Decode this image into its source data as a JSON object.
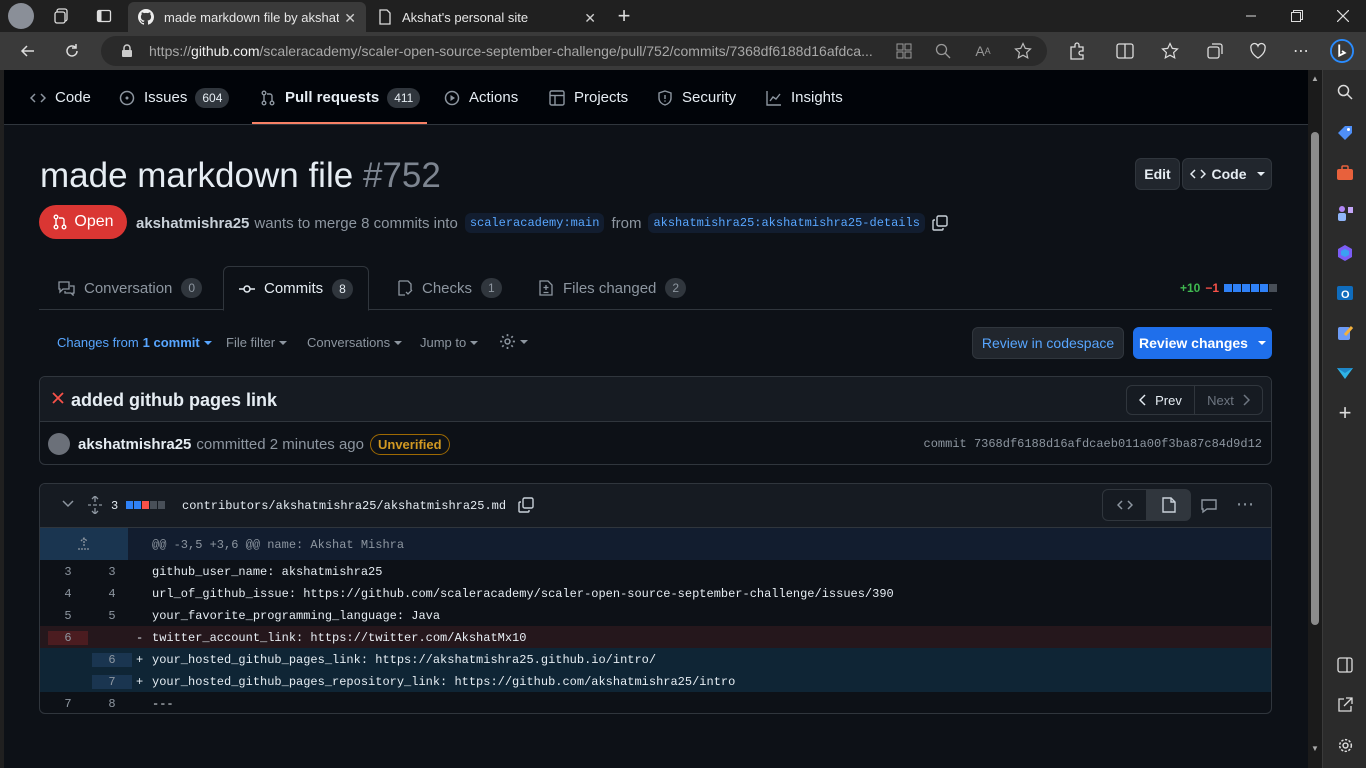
{
  "browser": {
    "tabs": [
      {
        "title": "made markdown file by akshatmishra25",
        "active": true
      },
      {
        "title": "Akshat's personal site",
        "active": false
      }
    ],
    "url_prefix": "https://",
    "url_domain": "github.com",
    "url_path": "/scaleracademy/scaler-open-source-september-challenge/pull/752/commits/7368df6188d16afdca..."
  },
  "repo_nav": {
    "code": "Code",
    "issues": "Issues",
    "issues_count": "604",
    "pulls": "Pull requests",
    "pulls_count": "411",
    "actions": "Actions",
    "projects": "Projects",
    "security": "Security",
    "insights": "Insights"
  },
  "pr": {
    "title": "made markdown file",
    "number": "#752",
    "edit_label": "Edit",
    "code_label": "Code",
    "state": "Open",
    "author": "akshatmishra25",
    "merge_text": "wants to merge 8 commits into",
    "base_branch": "scaleracademy:main",
    "from_text": "from",
    "head_branch": "akshatmishra25:akshatmishra25-details"
  },
  "pr_tabs": [
    {
      "label": "Conversation",
      "count": "0"
    },
    {
      "label": "Commits",
      "count": "8"
    },
    {
      "label": "Checks",
      "count": "1"
    },
    {
      "label": "Files changed",
      "count": "2"
    }
  ],
  "diffstat": {
    "additions": "+10",
    "deletions": "−1"
  },
  "toolbar": {
    "changes_from": "Changes from",
    "commit_count": "1 commit",
    "file_filter": "File filter",
    "conversations": "Conversations",
    "jump_to": "Jump to",
    "review_codespace": "Review in codespace",
    "review_changes": "Review changes"
  },
  "commit": {
    "message": "added github pages link",
    "prev": "Prev",
    "next": "Next",
    "author": "akshatmishra25",
    "action": "committed 2 minutes ago",
    "badge": "Unverified",
    "sha_label": "commit 7368df6188d16afdcaeb011a00f3ba87c84d9d12"
  },
  "file": {
    "changes": "3",
    "path": "contributors/akshatmishra25/akshatmishra25.md",
    "hunk": "@@ -3,5 +3,6 @@ name: Akshat Mishra",
    "lines": [
      {
        "old": "3",
        "new": "3",
        "sign": "",
        "text": "github_user_name: akshatmishra25",
        "type": "ctx"
      },
      {
        "old": "4",
        "new": "4",
        "sign": "",
        "text": "url_of_github_issue: https://github.com/scaleracademy/scaler-open-source-september-challenge/issues/390",
        "type": "ctx"
      },
      {
        "old": "5",
        "new": "5",
        "sign": "",
        "text": "your_favorite_programming_language: Java",
        "type": "ctx"
      },
      {
        "old": "6",
        "new": "",
        "sign": "-",
        "text": "twitter_account_link: https://twitter.com/AkshatMx10",
        "type": "del"
      },
      {
        "old": "",
        "new": "6",
        "sign": "+",
        "text": "your_hosted_github_pages_link: https://akshatmishra25.github.io/intro/",
        "type": "add"
      },
      {
        "old": "",
        "new": "7",
        "sign": "+",
        "text": "your_hosted_github_pages_repository_link: https://github.com/akshatmishra25/intro",
        "type": "add"
      },
      {
        "old": "7",
        "new": "8",
        "sign": "",
        "text": "---",
        "type": "ctx"
      }
    ]
  },
  "colors": {
    "accent_blue": "#1f6feb",
    "open_red": "#da3633",
    "add_green": "#3fb950",
    "del_red": "#f85149"
  }
}
